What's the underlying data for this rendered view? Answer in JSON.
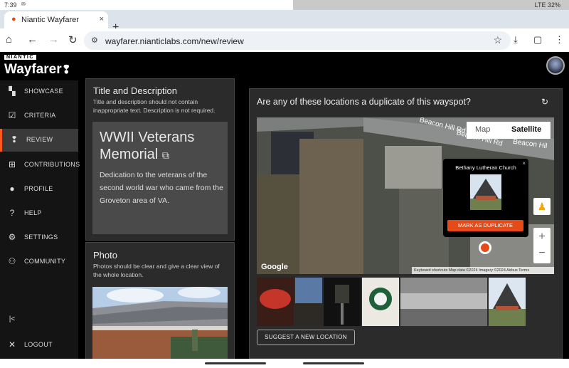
{
  "status_bar": {
    "time": "7:39",
    "icons_left": "mail",
    "right_text": "LTE 32%"
  },
  "browser": {
    "tab_title": "Niantic Wayfarer",
    "tab_close": "×",
    "new_tab": "+",
    "url": "wayfarer.nianticlabs.com/new/review"
  },
  "app": {
    "brand_small": "NIANTIC",
    "brand": "Wayfarer"
  },
  "sidebar": {
    "items": [
      {
        "label": "SHOWCASE",
        "icon": "showcase-icon"
      },
      {
        "label": "CRITERIA",
        "icon": "criteria-icon"
      },
      {
        "label": "REVIEW",
        "icon": "review-pin-icon"
      },
      {
        "label": "CONTRIBUTIONS",
        "icon": "contributions-icon"
      },
      {
        "label": "PROFILE",
        "icon": "profile-icon"
      },
      {
        "label": "HELP",
        "icon": "help-icon"
      },
      {
        "label": "SETTINGS",
        "icon": "settings-icon"
      },
      {
        "label": "COMMUNITY",
        "icon": "community-icon"
      }
    ],
    "collapse": "|<",
    "logout": "LOGOUT"
  },
  "title_panel": {
    "heading": "Title and Description",
    "sub": "Title and description should not contain inappropriate text. Description is not required.",
    "title": "WWII Veterans Memorial",
    "description": "Dedication to the veterans of the second world war who came from the Groveton area of VA."
  },
  "photo_panel": {
    "heading": "Photo",
    "sub": "Photos should be clear and give a clear view of the whole location."
  },
  "duplicate_panel": {
    "question": "Are any of these locations a duplicate of this wayspot?",
    "map_toggle": {
      "map": "Map",
      "satellite": "Satellite"
    },
    "road_labels": [
      "Beacon Hill Rd",
      "Beacon Hill Rd",
      "Beacon Hil"
    ],
    "popup": {
      "name": "Bethany Lutheran Church",
      "button": "MARK AS DUPLICATE",
      "close": "×"
    },
    "google": "Google",
    "attribution": "Keyboard shortcuts   Map data ©2024 Imagery ©2024 Airbus   Terms",
    "suggest_button": "SUGGEST A NEW LOCATION"
  },
  "colors": {
    "accent": "#e64a19",
    "panel": "#2b2b2b",
    "background": "#000000"
  }
}
